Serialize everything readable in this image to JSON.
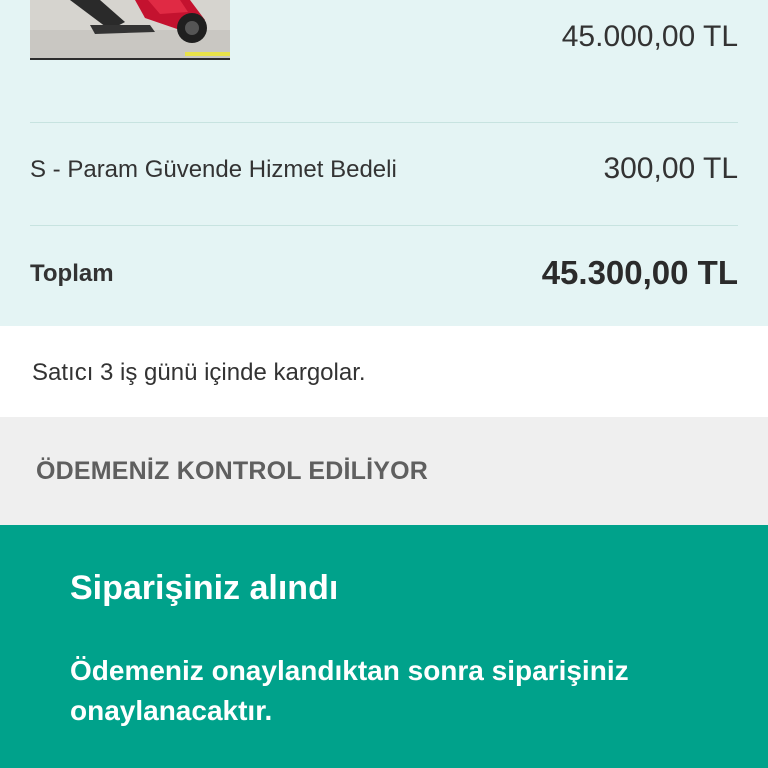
{
  "order_summary": {
    "product_image_alt": "scooter-photo",
    "product_price": "45.000,00 TL",
    "fee_label": "S - Param Güvende Hizmet Bedeli",
    "fee_value": "300,00 TL",
    "total_label": "Toplam",
    "total_value": "45.300,00 TL"
  },
  "shipping": {
    "note": "Satıcı 3 iş günü içinde kargolar."
  },
  "payment_status": {
    "title": "ÖDEMENİZ KONTROL EDİLİYOR"
  },
  "order_banner": {
    "title": "Siparişiniz alındı",
    "message": "Ödemeniz onaylandıktan sonra siparişiniz onaylanacaktır."
  },
  "colors": {
    "summary_bg": "#e4f4f4",
    "status_bg": "#efefef",
    "banner_bg": "#00a28b",
    "text": "#333333"
  }
}
